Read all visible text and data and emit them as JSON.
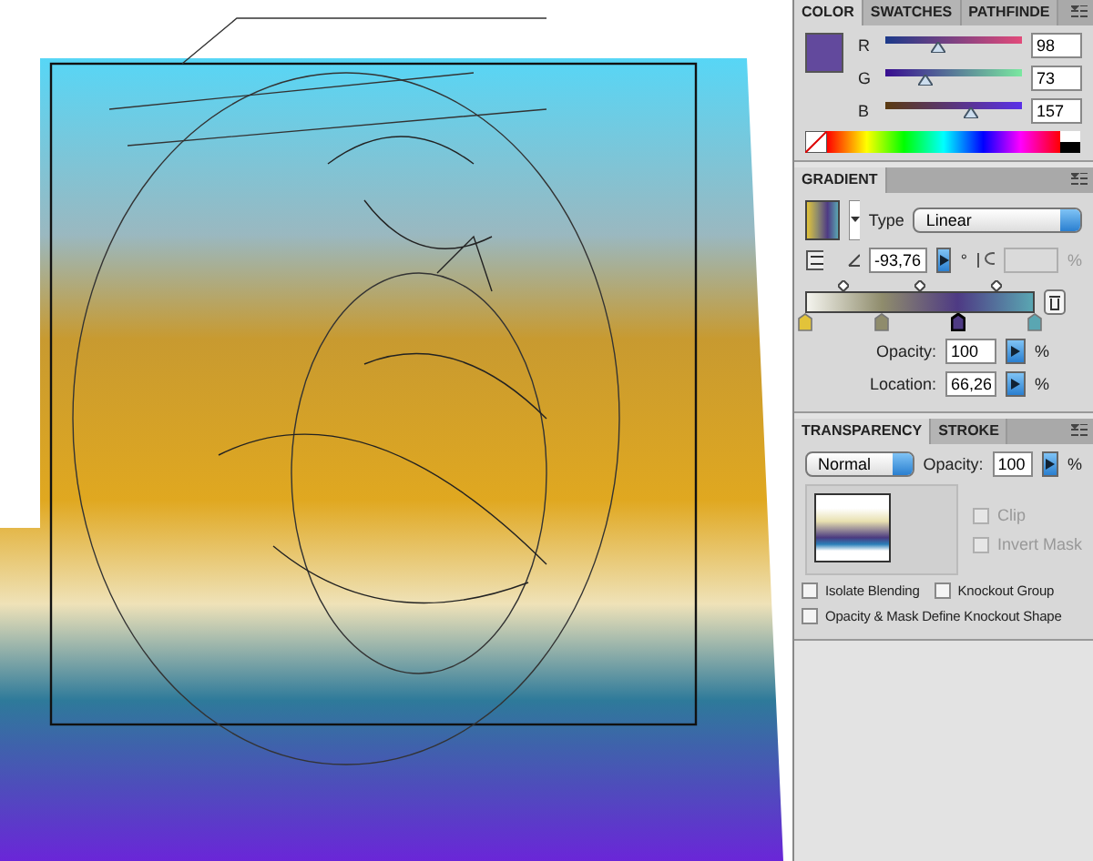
{
  "color_panel": {
    "tabs": [
      {
        "label": "COLOR",
        "selected": true
      },
      {
        "label": "SWATCHES",
        "selected": false
      },
      {
        "label": "PATHFINDE",
        "selected": false
      }
    ],
    "channels": [
      {
        "name": "R",
        "value": "98",
        "level": 0.38
      },
      {
        "name": "G",
        "value": "73",
        "level": 0.29
      },
      {
        "name": "B",
        "value": "157",
        "level": 0.62
      }
    ]
  },
  "gradient_panel": {
    "title": "GRADIENT",
    "type_label": "Type",
    "type": "Linear",
    "angle": "-93,76",
    "degree": "°",
    "aspect_disabled": true,
    "aspect_unit": "%",
    "stops": [
      {
        "color": "#e2c33a",
        "selected": false
      },
      {
        "color": "#8f8c6c",
        "selected": false
      },
      {
        "color": "#4e3a84",
        "selected": true
      },
      {
        "color": "#5aa6b2",
        "selected": false
      }
    ],
    "opacity_label": "Opacity:",
    "opacity": "100",
    "location_label": "Location:",
    "location": "66,26",
    "unit": "%"
  },
  "transparency_panel": {
    "tabs": [
      {
        "label": "TRANSPARENCY",
        "selected": true
      },
      {
        "label": "STROKE",
        "selected": false
      }
    ],
    "blend_mode": "Normal",
    "opacity_label": "Opacity:",
    "opacity": "100",
    "unit": "%",
    "mask_options": [
      {
        "label": "Clip",
        "checked": false,
        "disabled": true
      },
      {
        "label": "Invert Mask",
        "checked": false,
        "disabled": true
      }
    ],
    "options": [
      {
        "label": "Isolate Blending",
        "checked": false
      },
      {
        "label": "Knockout Group",
        "checked": false
      },
      {
        "label": "Opacity & Mask Define Knockout Shape",
        "checked": false
      }
    ]
  }
}
